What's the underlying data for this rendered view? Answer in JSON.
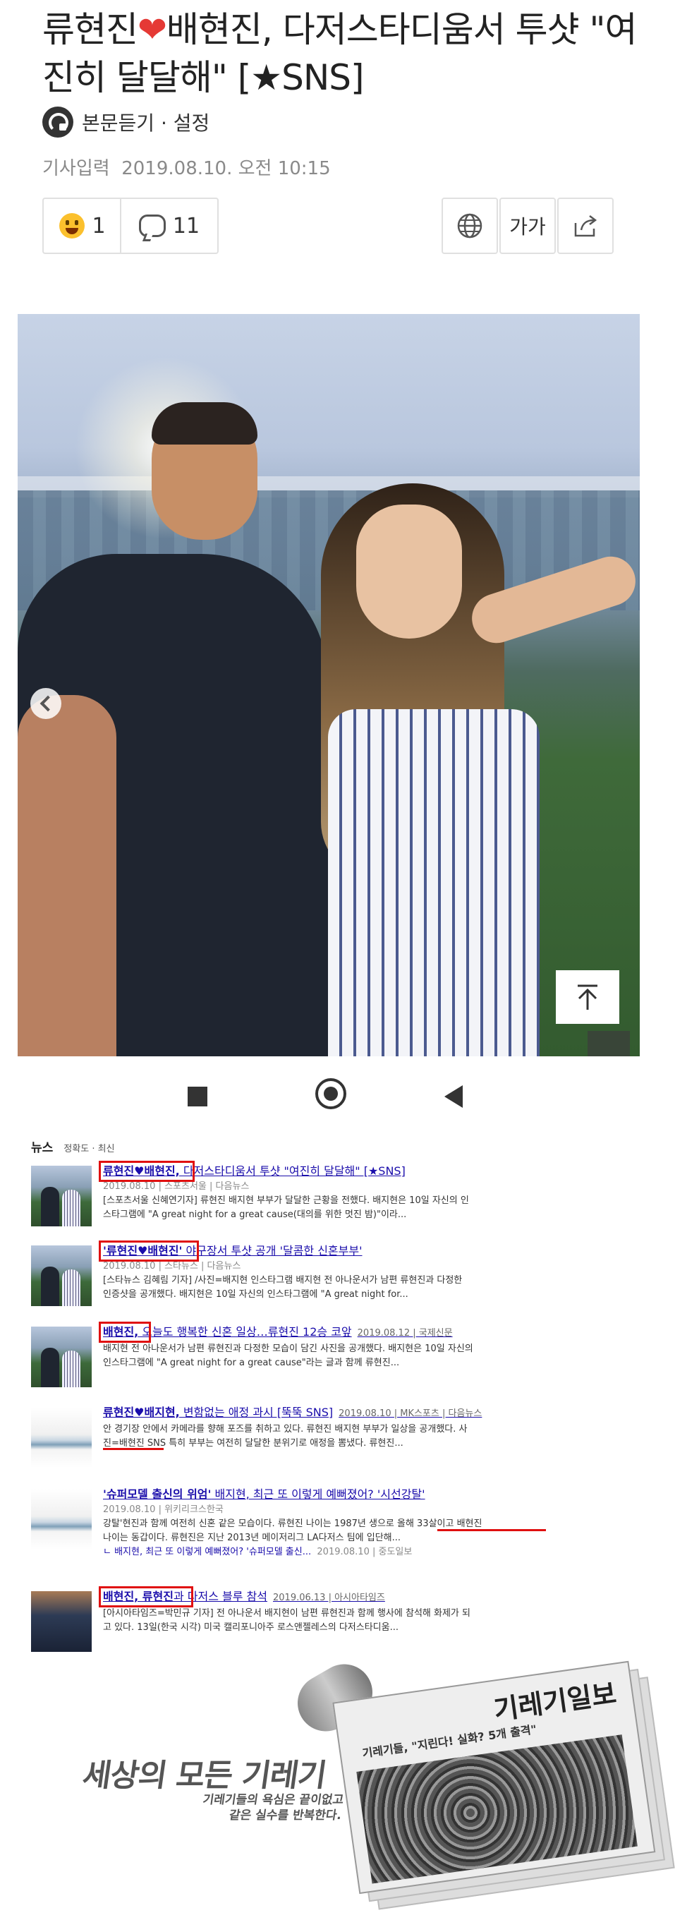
{
  "article": {
    "headline_part1": "류현진",
    "headline_heart": "❤",
    "headline_part2": "배현진, 다저스타디움서 투샷 \"여진히 달달해\" [★SNS]",
    "listen_label": "본문듣기 · 설정",
    "date_label": "기사입력",
    "date_value": "2019.08.10. 오전 10:15",
    "reaction_count": "1",
    "comment_count": "11",
    "font_button_label": "가가",
    "colors": {
      "text": "#222222",
      "heart": "#e53935",
      "date": "#8a8a8a"
    }
  },
  "icons": {
    "listen": "headphone-icon",
    "reaction": "smile-emoji-icon",
    "comment": "speech-bubble-icon",
    "globe": "globe-icon",
    "font": "font-size-icon",
    "share": "share-icon",
    "carousel_prev": "chevron-left-icon",
    "to_top": "arrow-up-icon",
    "expand": "expand-icon"
  },
  "news": {
    "tab_title": "뉴스",
    "tab_options": "정확도 · 최신",
    "results": [
      {
        "title_bold": "류현진♥배현진,",
        "title_rest": " 다저스타디움서 투샷 \"여진히 달달해\" [★SNS]",
        "meta": "2019.08.10 | 스포츠서울 | 다음뉴스",
        "snippet_line1": "[스포츠서울 신혜연기자] 류현진 배지현 부부가 달달한 근황을 전했다. 배지현은 10일 자신의 인",
        "snippet_line2": "스타그램에 \"A great night for a great cause(대의를 위한 멋진 밤)\"이라..."
      },
      {
        "title_bold": "'류현진♥배현진'",
        "title_rest": " 야구장서 투샷 공개 '달콤한 신혼부부'",
        "meta": "2019.08.10 | 스타뉴스 | 다음뉴스",
        "snippet_line1": "[스타뉴스 김혜림 기자] /사진=배지현 인스타그램 배지현 전 아나운서가 남편 류현진과 다정한",
        "snippet_line2": "인증샷을 공개했다. 배지현은 10일 자신의 인스타그램에 \"A great night for..."
      },
      {
        "title_bold": "배현진,",
        "title_rest": " 오늘도 행복한 신혼 일상…류현진 12승 코앞",
        "extra": "2019.08.12 | 국제신문",
        "snippet_line1": "배지현 전 아나운서가 남편 류현진과 다정한 모습이 담긴 사진을 공개했다. 배지현은 10일 자신의",
        "snippet_line2": "인스타그램에 \"A great night for a great cause\"라는 글과 함께 류현진..."
      },
      {
        "title_bold": "류현진♥배지현,",
        "title_rest": " 변함없는 애정 과시 [뚝뚝 SNS]",
        "extra": "2019.08.10 | MK스포츠 | 다음뉴스",
        "snippet_line1": "안 경기장 안에서 카메라를 향해 포즈를 취하고 있다. 류현진 배지현 부부가 일상을 공개했다. 사",
        "snippet_line2": "진=배현진 SNS 특히 부부는 여전히 달달한 분위기로 애정을 뽐냈다. 류현진..."
      },
      {
        "title_bold": "'슈퍼모델 출신의 위엄'",
        "title_rest": " 배지현, 최근 또 이렇게 예뻐졌어? '시선강탈'",
        "meta": "2019.08.10 | 위키리크스한국",
        "snippet_line1": "강탈'현진과 함께 여전히 신혼 같은 모습이다. 류현진 나이는 1987년 생으로 올해 33살이고 배현진",
        "snippet_line2": "나이는 동갑이다. 류현진은 지난 2013년 메이저리그 LA다저스 팀에 입단해...",
        "sub_title": "ㄴ 배지현, 최근 또 이렇게 예뻐졌어? '슈퍼모델 출신...",
        "sub_meta": "2019.08.10 | 중도일보"
      },
      {
        "title_bold": "배현진, 류현진",
        "title_rest": "과 다저스 블루 참석",
        "extra": "2019.06.13 | 아시아타임즈",
        "snippet_line1": "[아시아타임즈=박민규 기자] 전 아나운서 배지현이 남편 류현진과 함께 행사에 참석해 화제가 되",
        "snippet_line2": "고 있다. 13일(한국 시각) 미국 캘리포니아주 로스앤젤레스의 다저스타디움..."
      }
    ],
    "colors": {
      "link": "#1a0dab",
      "highlight": "#e01010"
    }
  },
  "watermark": {
    "main": "세상의 모든 기레기",
    "sub_line1": "기레기들의 욕심은 끝이없고",
    "sub_line2": "같은 실수를 반복한다.",
    "paper_title": "기레기일보",
    "paper_headline": "기레기들, \"지린다! 실화? 5개 출격\""
  }
}
